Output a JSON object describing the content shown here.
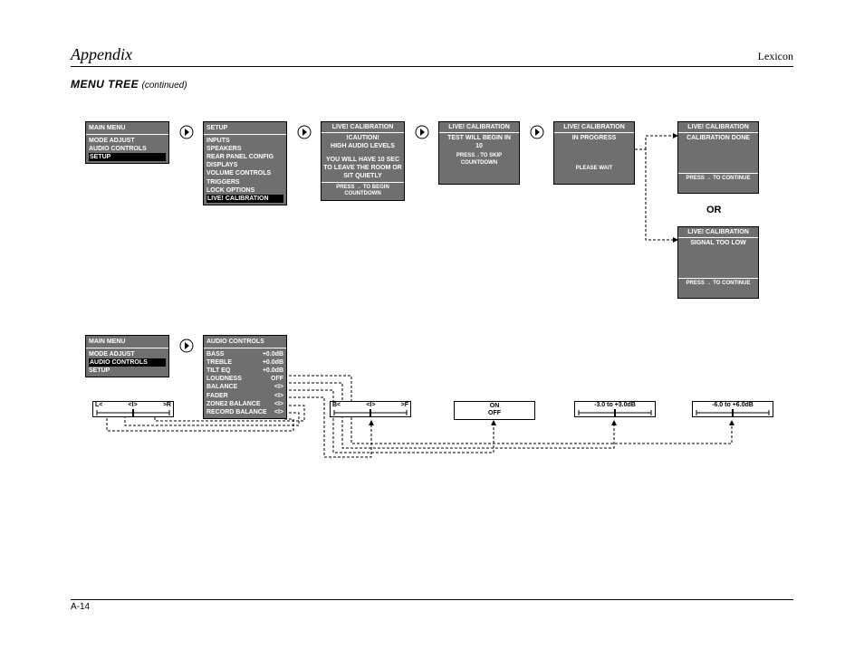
{
  "header": {
    "left": "Appendix",
    "right": "Lexicon"
  },
  "subtitle": {
    "main": "MENU TREE",
    "cont": "(continued)"
  },
  "footer": "A-14",
  "or": "OR",
  "arrowGlyph": "▶",
  "m1": {
    "title": "MAIN MENU",
    "i1": "MODE ADJUST",
    "i2": "AUDIO CONTROLS",
    "i3": "SETUP"
  },
  "m2": {
    "title": "SETUP",
    "i1": "INPUTS",
    "i2": "SPEAKERS",
    "i3": "REAR PANEL CONFIG",
    "i4": "DISPLAYS",
    "i5": "VOLUME CONTROLS",
    "i6": "TRIGGERS",
    "i7": "LOCK OPTIONS",
    "i8": "LIVE! CALIBRATION"
  },
  "m3": {
    "title": "LIVE! CALIBRATION",
    "l1": "!CAUTION!",
    "l2": "HIGH AUDIO LEVELS",
    "l3": "YOU WILL HAVE 10 SEC",
    "l4": "TO LEAVE THE ROOM OR",
    "l5": "SIT QUIETLY",
    "ft": "PRESS → TO BEGIN COUNTDOWN"
  },
  "m4": {
    "title": "LIVE! CALIBRATION",
    "l1": "TEST WILL BEGIN IN",
    "l2": "10",
    "ft": "PRESS→TO SKIP COUNTDOWN"
  },
  "m5": {
    "title": "LIVE! CALIBRATION",
    "l1": "IN PROGRESS",
    "ft": "PLEASE WAIT"
  },
  "m6": {
    "title": "LIVE! CALIBRATION",
    "l1": "CALIBRATION DONE",
    "ft": "PRESS → TO CONTINUE"
  },
  "m7": {
    "title": "LIVE! CALIBRATION",
    "l1": "SIGNAL TOO LOW",
    "ft": "PRESS → TO CONTINUE"
  },
  "m8": {
    "title": "MAIN MENU",
    "i1": "MODE ADJUST",
    "i2": "AUDIO CONTROLS",
    "i3": "SETUP"
  },
  "m9": {
    "title": "AUDIO CONTROLS",
    "r1l": "BASS",
    "r1v": "+0.0dB",
    "r2l": "TREBLE",
    "r2v": "+0.0dB",
    "r3l": "TILT EQ",
    "r3v": "+0.0dB",
    "r4l": "LOUDNESS",
    "r4v": "OFF",
    "r5l": "BALANCE",
    "r5v": "<I>",
    "r6l": "FADER",
    "r6v": "<I>",
    "r7l": "ZONE2 BALANCE",
    "r7v": "<I>",
    "r8l": "RECORD BALANCE",
    "r8v": "<I>"
  },
  "s1": {
    "left": "L<",
    "mid": "<I>",
    "right": ">R"
  },
  "s2": {
    "left": "B<",
    "mid": "<I>",
    "right": ">F"
  },
  "s3": {
    "l1": "ON",
    "l2": "OFF"
  },
  "s4": {
    "txt": "-3.0 to +3.0dB"
  },
  "s5": {
    "txt": "-6.0 to +6.0dB"
  }
}
